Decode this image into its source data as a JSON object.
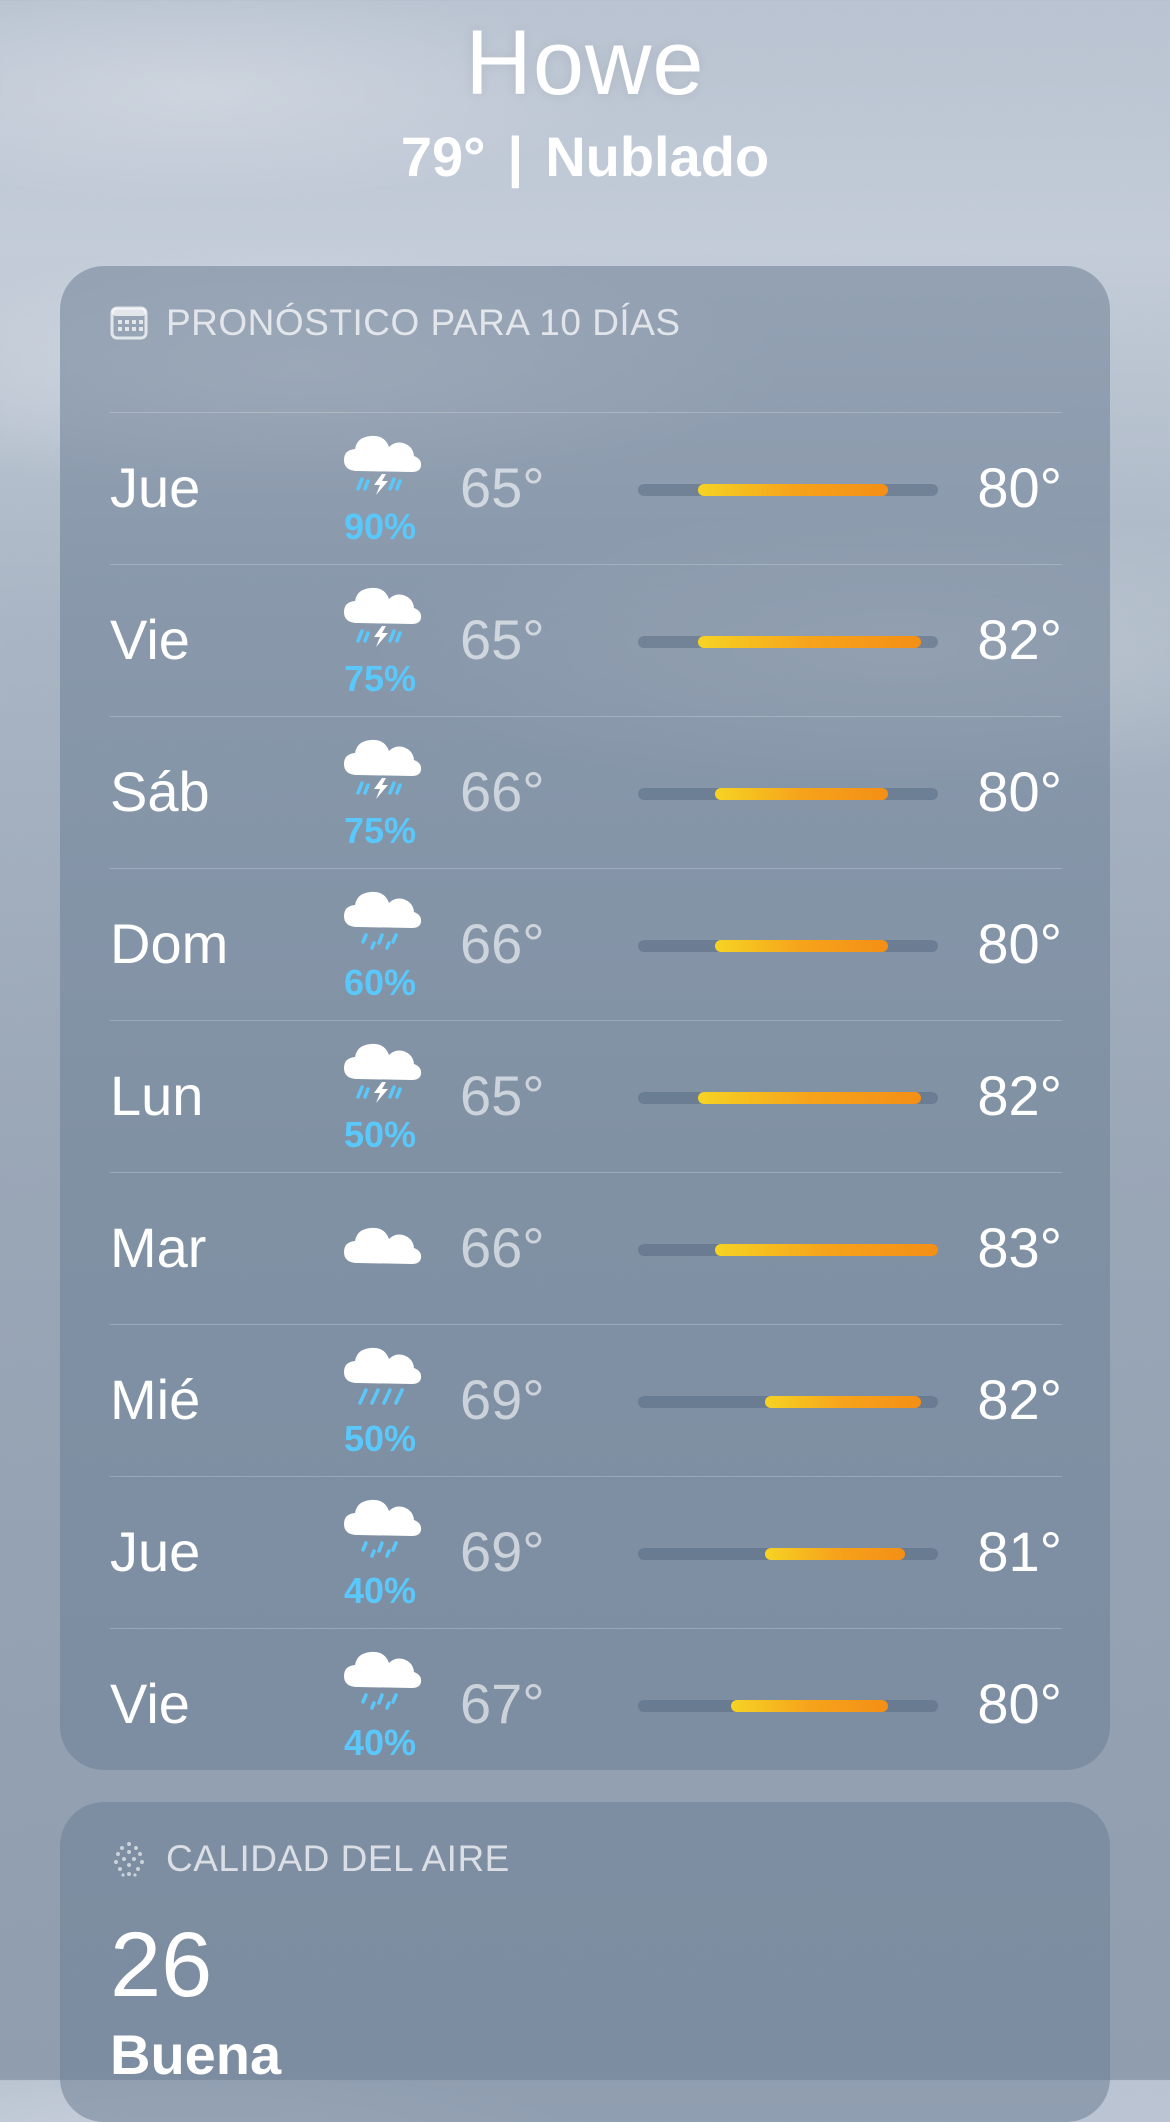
{
  "location": {
    "city": "Howe",
    "temperature": "79°",
    "separator": "|",
    "condition": "Nublado"
  },
  "forecast": {
    "title": "PRONÓSTICO PARA 10 DÍAS",
    "title_icon": "calendar-icon",
    "range_min": 65,
    "range_max": 83,
    "days": [
      {
        "day": "Jue",
        "icon": "thunderstorm-icon",
        "precip": "90%",
        "low": "65°",
        "high": "80°",
        "low_value": 65,
        "high_value": 80
      },
      {
        "day": "Vie",
        "icon": "thunderstorm-icon",
        "precip": "75%",
        "low": "65°",
        "high": "82°",
        "low_value": 65,
        "high_value": 82
      },
      {
        "day": "Sáb",
        "icon": "thunderstorm-icon",
        "precip": "75%",
        "low": "66°",
        "high": "80°",
        "low_value": 66,
        "high_value": 80
      },
      {
        "day": "Dom",
        "icon": "rain-icon",
        "precip": "60%",
        "low": "66°",
        "high": "80°",
        "low_value": 66,
        "high_value": 80
      },
      {
        "day": "Lun",
        "icon": "thunderstorm-icon",
        "precip": "50%",
        "low": "65°",
        "high": "82°",
        "low_value": 65,
        "high_value": 82
      },
      {
        "day": "Mar",
        "icon": "cloud-icon",
        "precip": "",
        "low": "66°",
        "high": "83°",
        "low_value": 66,
        "high_value": 83
      },
      {
        "day": "Mié",
        "icon": "heavy-rain-icon",
        "precip": "50%",
        "low": "69°",
        "high": "82°",
        "low_value": 69,
        "high_value": 82
      },
      {
        "day": "Jue",
        "icon": "rain-icon",
        "precip": "40%",
        "low": "69°",
        "high": "81°",
        "low_value": 69,
        "high_value": 81
      },
      {
        "day": "Vie",
        "icon": "rain-icon",
        "precip": "40%",
        "low": "67°",
        "high": "80°",
        "low_value": 67,
        "high_value": 80
      }
    ]
  },
  "air_quality": {
    "title": "CALIDAD DEL AIRE",
    "title_icon": "air-quality-icon",
    "value": "26",
    "category": "Buena"
  },
  "colors": {
    "precip": "#5ac8fa",
    "bar_start": "#f6d323",
    "bar_end": "#f48f16"
  }
}
